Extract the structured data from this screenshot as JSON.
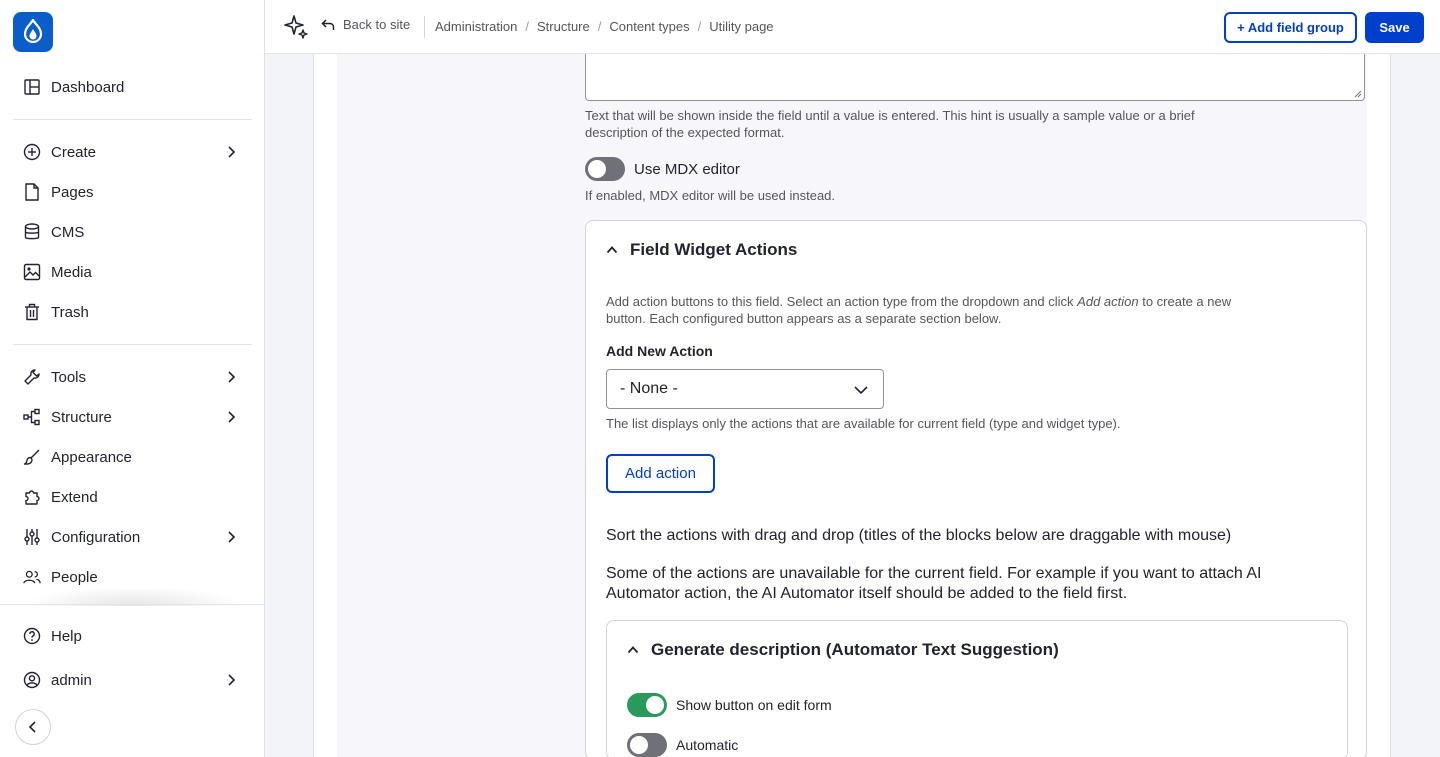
{
  "app": {
    "brand_color": "#0b5ec9",
    "accent": "#003ecc",
    "toggle_on": "#2a9a5c"
  },
  "sidebar": {
    "items": [
      {
        "label": "Dashboard",
        "icon": "dashboard-icon"
      },
      {
        "label": "Create",
        "icon": "plus-circle-icon",
        "has_submenu": true
      },
      {
        "label": "Pages",
        "icon": "file-icon"
      },
      {
        "label": "CMS",
        "icon": "database-icon"
      },
      {
        "label": "Media",
        "icon": "image-icon"
      },
      {
        "label": "Trash",
        "icon": "trash-icon"
      },
      {
        "label": "Tools",
        "icon": "wrench-icon",
        "has_submenu": true
      },
      {
        "label": "Structure",
        "icon": "structure-icon",
        "has_submenu": true
      },
      {
        "label": "Appearance",
        "icon": "brush-icon"
      },
      {
        "label": "Extend",
        "icon": "puzzle-icon"
      },
      {
        "label": "Configuration",
        "icon": "sliders-icon",
        "has_submenu": true
      },
      {
        "label": "People",
        "icon": "people-icon"
      }
    ],
    "bottom": [
      {
        "label": "Help",
        "icon": "help-icon"
      },
      {
        "label": "admin",
        "icon": "user-icon",
        "has_submenu": true
      }
    ]
  },
  "topbar": {
    "back_label": "Back to site",
    "breadcrumb": [
      "Administration",
      "Structure",
      "Content types",
      "Utility page"
    ],
    "add_field_group_label": "+ Add field group",
    "save_label": "Save"
  },
  "form": {
    "placeholder_help": "Text that will be shown inside the field until a value is entered. This hint is usually a sample value or a brief description of the expected format.",
    "mdx_toggle_label": "Use MDX editor",
    "mdx_toggle_on": false,
    "mdx_help": "If enabled, MDX editor will be used instead.",
    "widget_actions": {
      "title": "Field Widget Actions",
      "intro_prefix": "Add action buttons to this field. Select an action type from the dropdown and click ",
      "intro_em": "Add action",
      "intro_suffix": " to create a new button. Each configured button appears as a separate section below.",
      "add_new_label": "Add New Action",
      "select_value": "- None -",
      "select_help": "The list displays only the actions that are available for current field (type and widget type).",
      "add_action_label": "Add action",
      "sort_text": "Sort the actions with drag and drop (titles of the blocks below are draggable with mouse)",
      "unavailable_text": "Some of the actions are unavailable for the current field. For example if you want to attach AI Automator action, the AI Automator itself should be added to the field first.",
      "action_block": {
        "title": "Generate description (Automator Text Suggestion)",
        "show_button_label": "Show button on edit form",
        "show_button_on": true,
        "automatic_label": "Automatic",
        "automatic_on": false
      }
    }
  }
}
